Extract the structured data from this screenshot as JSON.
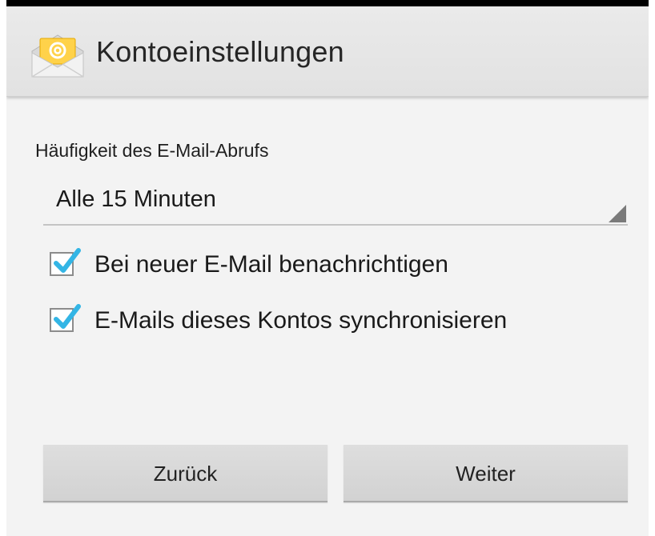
{
  "action_bar": {
    "title": "Kontoeinstellungen",
    "icon": "email-envelope-icon"
  },
  "settings": {
    "frequency_label": "Häufigkeit des E-Mail-Abrufs",
    "frequency_value": "Alle 15 Minuten",
    "checkboxes": [
      {
        "label": "Bei neuer E-Mail benachrichtigen",
        "checked": true
      },
      {
        "label": "E-Mails dieses Kontos synchronisieren",
        "checked": true
      }
    ]
  },
  "buttons": {
    "back_label": "Zurück",
    "next_label": "Weiter"
  },
  "colors": {
    "checkmark": "#33b5e5",
    "background": "#f3f3f3",
    "action_bar": "#e6e6e6"
  }
}
